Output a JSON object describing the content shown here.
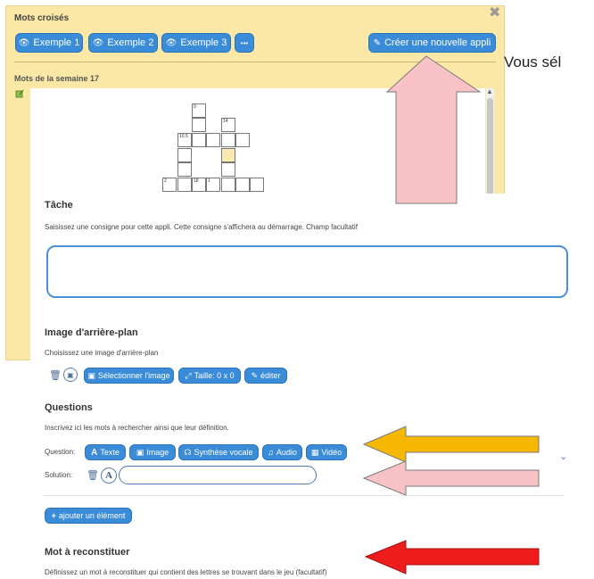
{
  "background_window": {
    "title": "Mots croisés",
    "close_icon": "✖",
    "examples": [
      "Exemple 1",
      "Exemple 2",
      "Exemple 3"
    ],
    "more_label": "•••",
    "create_label": "Créer une nouvelle appli",
    "week_label": "Mots de la semaine 17",
    "crossword_numbers": [
      "9",
      "14",
      "10.5",
      "2",
      "18",
      "1"
    ]
  },
  "side_text": "Vous sél",
  "panel": {
    "task": {
      "title": "Tâche",
      "description": "Saisissez une consigne pour cette appli. Cette consigne s'affichera au démarrage. Champ facultatif",
      "value": ""
    },
    "background_image": {
      "title": "Image d'arrière-plan",
      "description": "Choisissez une image d'arrière-plan",
      "select_label": "Sélectionner l'image",
      "size_label": "Taille: 0 x 0",
      "edit_label": "éditer"
    },
    "questions": {
      "title": "Questions",
      "description": "Inscrivez ici les mots à rechercher ainsi que leur définition.",
      "question_label": "Question:",
      "types": [
        "Texte",
        "Image",
        "Synthèse vocale",
        "Audio",
        "Vidéo"
      ],
      "solution_label": "Solution:",
      "solution_value": "",
      "add_label": "ajouter un élément"
    },
    "word": {
      "title": "Mot à reconstituer",
      "description": "Définissez un mot à reconstituer qui contient des lettres se trouvant dans le jeu (facultatif)"
    }
  },
  "colors": {
    "accent": "#3a8bd8",
    "yellow_bg": "#fbe8a6",
    "arrow_pink": "#f8c2c6",
    "arrow_orange": "#f6b700",
    "arrow_red": "#ee1c1c"
  }
}
